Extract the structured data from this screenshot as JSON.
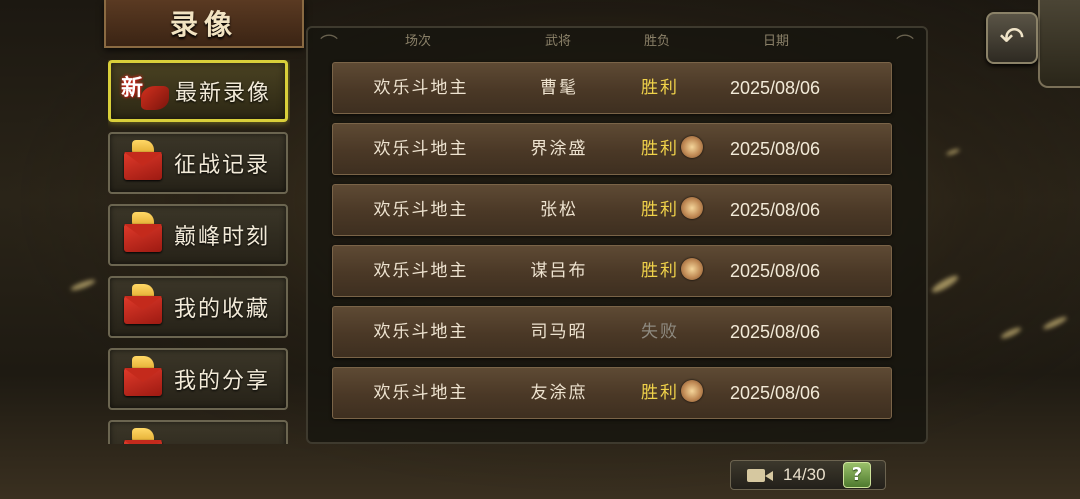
{
  "title": "录像",
  "sidebar": {
    "items": [
      {
        "label": "最新录像",
        "badge": "新",
        "icon": "new-ribbon-icon",
        "active": true
      },
      {
        "label": "征战记录",
        "icon": "envelope-flag-icon",
        "active": false
      },
      {
        "label": "巅峰时刻",
        "icon": "envelope-arrow-icon",
        "active": false
      },
      {
        "label": "我的收藏",
        "icon": "envelope-star-icon",
        "active": false
      },
      {
        "label": "我的分享",
        "icon": "envelope-share-icon",
        "active": false
      },
      {
        "label": "",
        "icon": "envelope-icon",
        "active": false
      }
    ]
  },
  "table": {
    "headers": [
      "场次",
      "武将",
      "胜负",
      "日期"
    ],
    "rows": [
      {
        "mode": "欢乐斗地主",
        "general": "曹髦",
        "result": "胜利",
        "mvp": false,
        "date": "2025/08/06"
      },
      {
        "mode": "欢乐斗地主",
        "general": "界涂盛",
        "result": "胜利",
        "mvp": true,
        "date": "2025/08/06"
      },
      {
        "mode": "欢乐斗地主",
        "general": "张松",
        "result": "胜利",
        "mvp": true,
        "date": "2025/08/06"
      },
      {
        "mode": "欢乐斗地主",
        "general": "谋吕布",
        "result": "胜利",
        "mvp": true,
        "date": "2025/08/06"
      },
      {
        "mode": "欢乐斗地主",
        "general": "司马昭",
        "result": "失败",
        "mvp": false,
        "date": "2025/08/06"
      },
      {
        "mode": "欢乐斗地主",
        "general": "友涂庶",
        "result": "胜利",
        "mvp": true,
        "date": "2025/08/06"
      }
    ]
  },
  "footer": {
    "count": "14/30",
    "help_label": "?"
  },
  "colors": {
    "win": "#f0d24a",
    "lose": "#8e8a80",
    "active_border": "#d9cf3a"
  }
}
